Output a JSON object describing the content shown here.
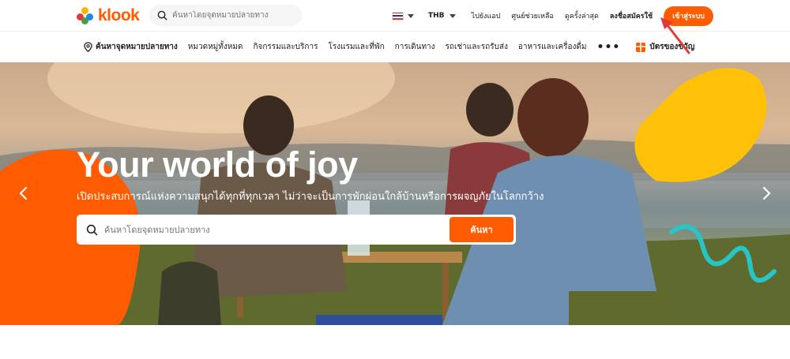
{
  "brand": {
    "name": "klook",
    "accent": "#ff5b00"
  },
  "top_search": {
    "placeholder": "ค้นหาโดยจุดหมายปลายทาง",
    "icon": "search-icon"
  },
  "header": {
    "currency": "THB",
    "links": [
      "ไปยังแอป",
      "ศูนย์ช่วยเหลือ",
      "ดูครั้งล่าสุด"
    ],
    "signup": "ลงชื่อสมัครใช้",
    "login": "เข้าสู่ระบบ"
  },
  "nav": {
    "destination": "ค้นหาจุดหมายปลายทาง",
    "items": [
      "หมวดหมู่ทั้งหมด",
      "กิจกรรมและบริการ",
      "โรงแรมและที่พัก",
      "การเดินทาง",
      "รถเช่าและรถรับส่ง",
      "อาหารและเครื่องดื่ม"
    ],
    "more": "•••",
    "gift": "บัตรของขวัญ"
  },
  "hero": {
    "title": "Your world of joy",
    "subtitle": "เปิดประสบการณ์แห่งความสนุกได้ทุกที่ทุกเวลา ไม่ว่าจะเป็นการพักผ่อนใกล้บ้านหรือการผจญภัยในโลกกว้าง",
    "search_placeholder": "ค้นหาโดยจุดหมายปลายทาง",
    "search_button": "ค้นหา"
  },
  "colors": {
    "orange": "#ff5b00",
    "yellow": "#ffc107",
    "teal": "#26c6c6",
    "annotation_arrow": "#e53935"
  }
}
